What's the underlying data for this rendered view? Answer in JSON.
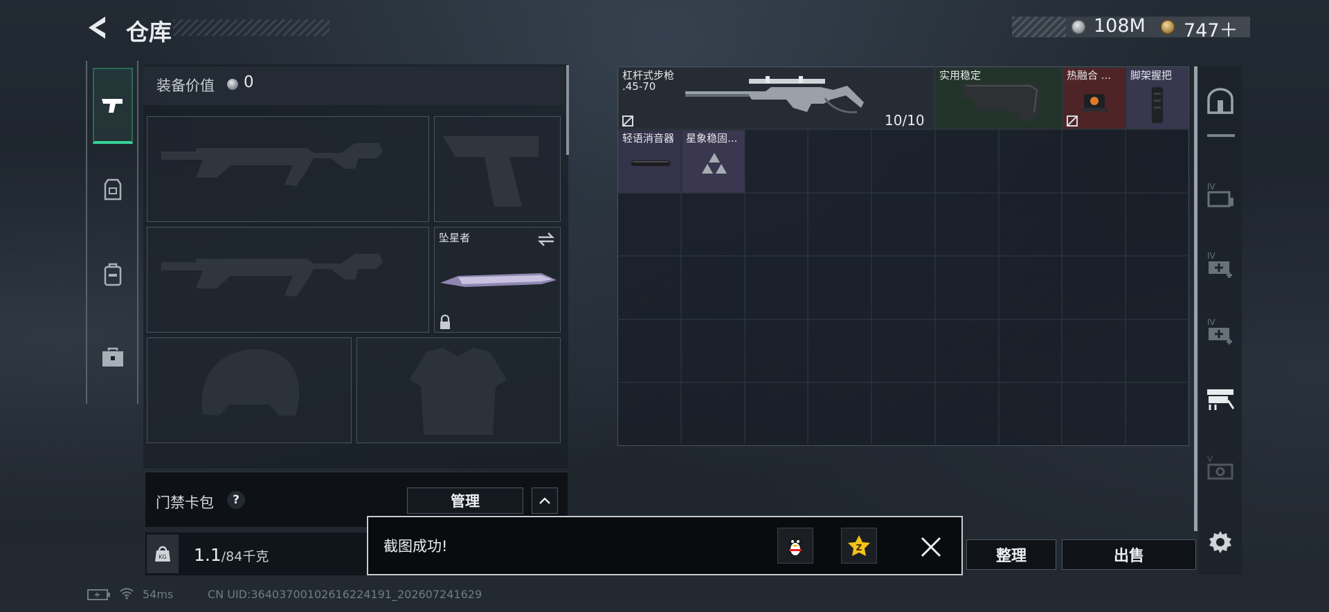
{
  "header": {
    "title": "仓库"
  },
  "currency": {
    "silver": "108M",
    "gold": "747＋"
  },
  "equipment": {
    "label": "装备价值",
    "value": "0",
    "melee_slot_name": "坠星者"
  },
  "card_pack": {
    "label": "门禁卡包",
    "help": "?",
    "manage_label": "管理"
  },
  "weight": {
    "current": "1.1",
    "max": "/84千克"
  },
  "warehouse": {
    "items": [
      {
        "name_line1": "杠杆式步枪",
        "name_line2": ".45-70",
        "count": "10/10"
      },
      {
        "name": "实用稳定"
      },
      {
        "name": "热融合 ..."
      },
      {
        "name": "脚架握把"
      },
      {
        "name": "轻语消音器"
      },
      {
        "name": "星象稳固..."
      }
    ]
  },
  "buttons": {
    "sort_label": "整理",
    "sell_label": "出售"
  },
  "toast": {
    "message": "截图成功!"
  },
  "status": {
    "ping": "54ms",
    "uid": "CN UID:3640370010261622419​1_202607241629"
  },
  "colors": {
    "active_tab": "#37d59a",
    "rarity_red": "#5a2a2e",
    "rarity_purple": "#3b3750",
    "rarity_green": "#24342b"
  }
}
